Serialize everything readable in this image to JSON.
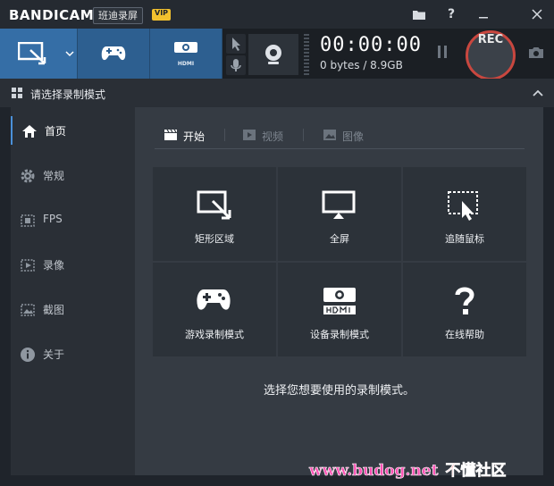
{
  "titlebar": {
    "brand_bandi": "BANDI",
    "brand_cam": "CAM",
    "subtitle": "班迪录屏",
    "badge": "VIP",
    "icons": [
      "folder-icon",
      "help-icon",
      "minimize-icon",
      "close-icon"
    ]
  },
  "toolbar": {
    "modes": [
      "rectangle-area-mode",
      "game-mode",
      "device-mode"
    ],
    "hdmi_label": "HDMI",
    "timer": "00:00:00",
    "size_text": "0 bytes / 8.9GB",
    "rec_label": "REC"
  },
  "subbar": {
    "title": "请选择录制模式"
  },
  "sidebar": {
    "items": [
      {
        "label": "首页",
        "icon": "home-icon",
        "active": true
      },
      {
        "label": "常规",
        "icon": "gear-icon",
        "active": false
      },
      {
        "label": "FPS",
        "icon": "fps-icon",
        "active": false
      },
      {
        "label": "录像",
        "icon": "video-settings-icon",
        "active": false
      },
      {
        "label": "截图",
        "icon": "image-settings-icon",
        "active": false
      },
      {
        "label": "关于",
        "icon": "info-icon",
        "active": false
      }
    ]
  },
  "main": {
    "tabs": [
      {
        "label": "开始",
        "icon": "clapper-icon",
        "active": true
      },
      {
        "label": "视频",
        "icon": "video-play-icon",
        "active": false
      },
      {
        "label": "图像",
        "icon": "image-icon",
        "active": false
      }
    ],
    "tiles": [
      {
        "label": "矩形区域",
        "icon": "rectangle-area-icon"
      },
      {
        "label": "全屏",
        "icon": "monitor-icon"
      },
      {
        "label": "追随鼠标",
        "icon": "follow-mouse-icon"
      },
      {
        "label": "游戏录制模式",
        "icon": "gamepad-icon"
      },
      {
        "label": "设备录制模式",
        "icon": "hdmi-icon"
      },
      {
        "label": "在线帮助",
        "icon": "question-icon"
      }
    ],
    "hint": "选择您想要使用的录制模式。"
  },
  "watermark": {
    "url": "www.budog.net",
    "cn": "不懂社区"
  },
  "colors": {
    "accent_blue": "#2d5f90",
    "rec_ring": "#c9473f",
    "vip_yellow": "#f2c12e"
  }
}
